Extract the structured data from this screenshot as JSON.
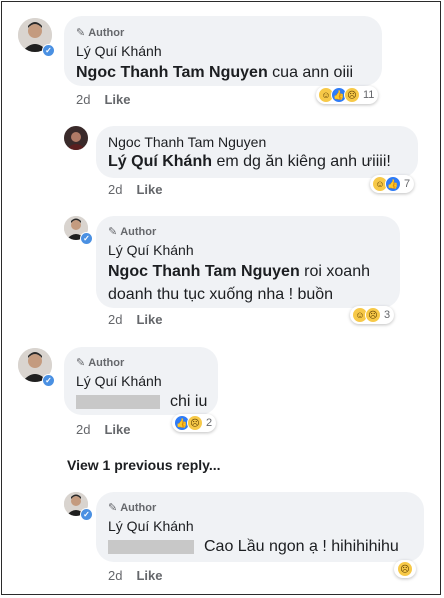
{
  "comments": [
    {
      "badge": "Author",
      "name": "Lý Quí Khánh",
      "mention": "Ngoc Thanh Tam Nguyen",
      "text": " cua ann oiii",
      "time": "2d",
      "like": "Like",
      "reaction_count": "11"
    },
    {
      "name": "Ngoc Thanh Tam Nguyen",
      "mention": "Lý Quí Khánh",
      "text": " em dg ăn kiêng anh ưiiii!",
      "time": "2d",
      "like": "Like",
      "reaction_count": "7"
    },
    {
      "badge": "Author",
      "name": "Lý Quí Khánh",
      "mention": "Ngoc Thanh Tam Nguyen",
      "text": " roi xoanh",
      "text2": "doanh thu tục xuống nha ! buồn",
      "time": "2d",
      "like": "Like",
      "reaction_count": "3"
    },
    {
      "badge": "Author",
      "name": "Lý Quí Khánh",
      "text": "chi iu",
      "time": "2d",
      "like": "Like",
      "reaction_count": "2"
    },
    {
      "badge": "Author",
      "name": "Lý Quí Khánh",
      "text": "Cao Lầu ngon ạ ! hihihihihu",
      "time": "2d",
      "like": "Like"
    }
  ],
  "view_previous": "View 1 previous reply...",
  "colors": {
    "bubble": "#f0f2f5",
    "link_blue": "#2e7bf6",
    "verified": "#4a90e2"
  },
  "icons": [
    "pencil-icon",
    "verified-badge-icon",
    "haha-reaction-icon",
    "like-reaction-icon",
    "sad-reaction-icon"
  ]
}
